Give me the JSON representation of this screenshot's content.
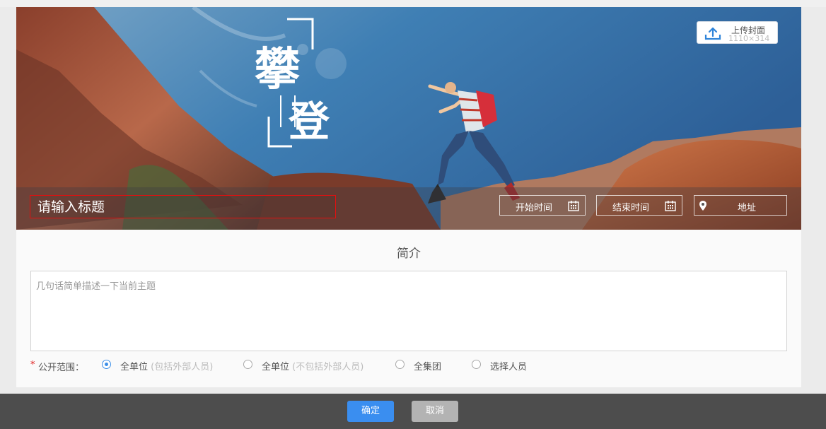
{
  "banner": {
    "upload_label": "上传封面",
    "upload_size": "1110×314",
    "logo_text_main_1": "攀",
    "logo_text_main_2": "登",
    "title_placeholder": "请输入标题",
    "start_time_label": "开始时间",
    "end_time_label": "结束时间",
    "address_label": "地址"
  },
  "intro": {
    "section_title": "简介",
    "description_placeholder": "几句话简单描述一下当前主题"
  },
  "scope": {
    "required_mark": "*",
    "label": "公开范围：",
    "options": [
      {
        "label": "全单位",
        "note": "(包括外部人员)",
        "selected": true
      },
      {
        "label": "全单位",
        "note": "(不包括外部人员)",
        "selected": false
      },
      {
        "label": "全集团",
        "note": "",
        "selected": false
      },
      {
        "label": "选择人员",
        "note": "",
        "selected": false
      }
    ]
  },
  "footer": {
    "confirm_label": "确定",
    "cancel_label": "取消"
  },
  "colors": {
    "accent": "#3a8ef0",
    "required": "#e02020",
    "title_border": "#e01010"
  }
}
